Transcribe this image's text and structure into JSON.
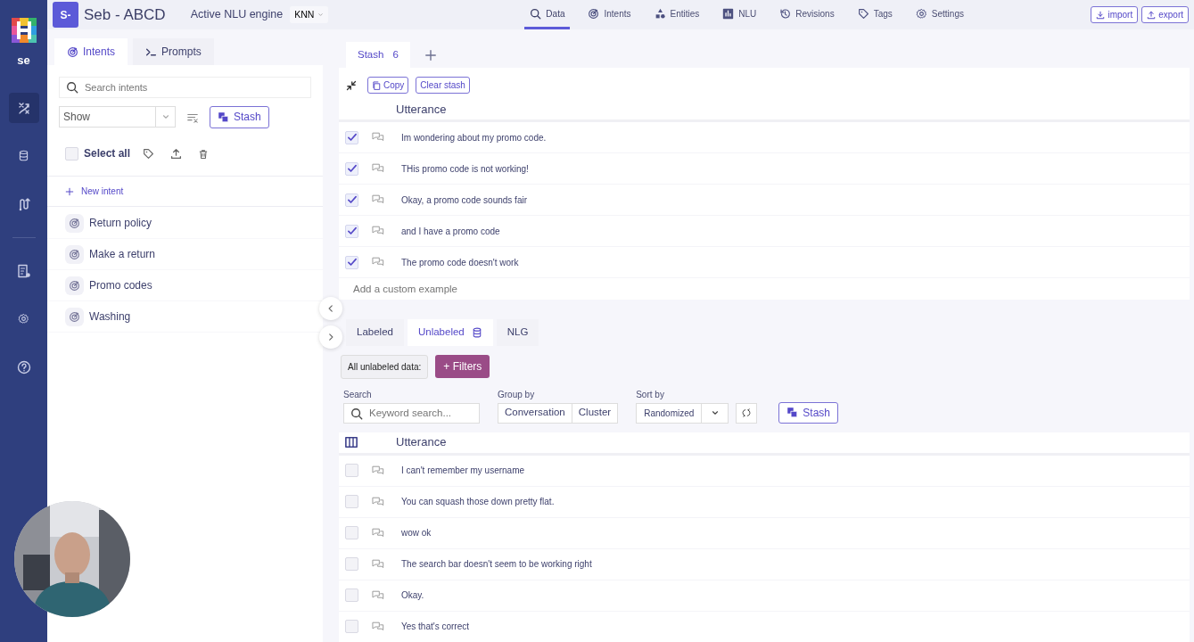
{
  "rail": {
    "workspace": "se",
    "items": [
      {
        "selected": true
      },
      {
        "selected": false
      },
      {
        "selected": false
      },
      {
        "selected": false
      },
      {
        "selected": false
      },
      {
        "selected": false
      }
    ]
  },
  "header": {
    "project_badge": "S-",
    "project_name": "Seb - ABCD",
    "engine_label": "Active NLU engine",
    "engine_value": "KNN",
    "nav": [
      {
        "label": "Data",
        "selected": true
      },
      {
        "label": "Intents",
        "selected": false
      },
      {
        "label": "Entities",
        "selected": false
      },
      {
        "label": "NLU",
        "selected": false
      },
      {
        "label": "Revisions",
        "selected": false
      },
      {
        "label": "Tags",
        "selected": false
      },
      {
        "label": "Settings",
        "selected": false
      }
    ],
    "buttons": [
      "import",
      "export"
    ]
  },
  "left_panel": {
    "tabs": [
      {
        "label": "Intents",
        "selected": true
      },
      {
        "label": "Prompts",
        "selected": false
      }
    ],
    "search": {
      "placeholder": "Search intents"
    },
    "show_select": "Show",
    "stash_button": "Stash",
    "select_all": {
      "label": "Select all",
      "checked": false
    },
    "new_intent": "New intent",
    "intents": [
      "Return policy",
      "Make a return",
      "Promo codes",
      "Washing"
    ]
  },
  "stash": {
    "tab_label": "Stash",
    "count": "6",
    "actions": [
      "Copy",
      "Clear stash"
    ],
    "column": "Utterance",
    "rows": [
      {
        "text": "Im wondering about my promo code.",
        "checked": true
      },
      {
        "text": "THis promo code is not working!",
        "checked": true
      },
      {
        "text": "Okay, a promo code sounds fair",
        "checked": true
      },
      {
        "text": "and I have a promo code",
        "checked": true
      },
      {
        "text": "The promo code doesn't work",
        "checked": true
      }
    ],
    "add_placeholder": "Add a custom example"
  },
  "data": {
    "tabs": [
      {
        "label": "Labeled",
        "selected": false
      },
      {
        "label": "Unlabeled",
        "selected": true
      },
      {
        "label": "NLG",
        "selected": false
      }
    ],
    "filter_label": "All unlabeled data:",
    "filters_button": "+ Filters",
    "search": {
      "label": "Search",
      "placeholder": "Keyword search..."
    },
    "group_by": {
      "label": "Group by",
      "options": [
        "Conversation",
        "Cluster"
      ]
    },
    "sort_by": {
      "label": "Sort by",
      "value": "Randomized"
    },
    "stash_button": "Stash",
    "column": "Utterance",
    "rows": [
      {
        "text": "I can't remember my username",
        "checked": false
      },
      {
        "text": "You can squash those down pretty flat.",
        "checked": false
      },
      {
        "text": "wow ok",
        "checked": false
      },
      {
        "text": "The search bar doesn't seem to be working right",
        "checked": false
      },
      {
        "text": "Okay.",
        "checked": false
      },
      {
        "text": "Yes that's correct",
        "checked": false
      }
    ]
  }
}
